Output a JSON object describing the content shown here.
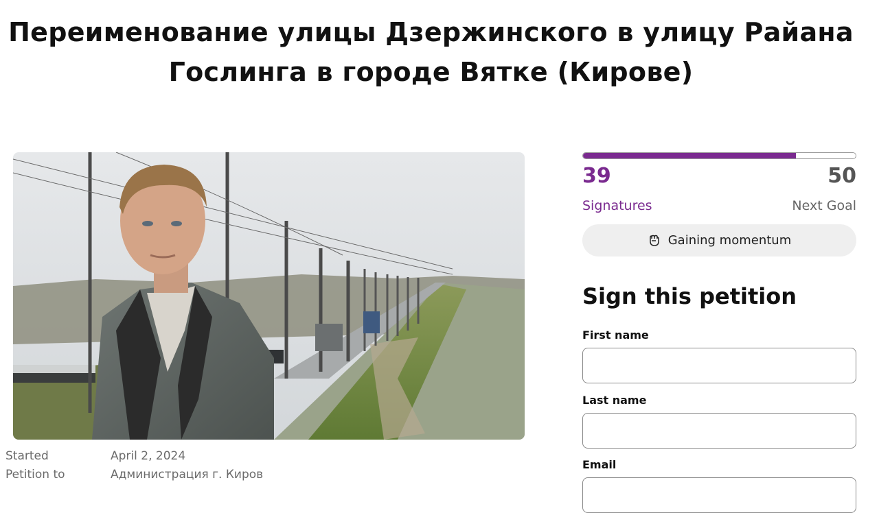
{
  "petition": {
    "title": "Переименование улицы Дзержинского в улицу Райана Гослинга в городе Вятке (Кирове)"
  },
  "meta": {
    "started_label": "Started",
    "started_value": "April 2, 2024",
    "petition_to_label": "Petition to",
    "petition_to_value": "Администрация г. Киров"
  },
  "signatures": {
    "count": "39",
    "count_label": "Signatures",
    "goal": "50",
    "goal_label": "Next Goal",
    "progress_fraction": 0.78
  },
  "momentum": {
    "label": "Gaining momentum",
    "icon": "fist-icon"
  },
  "form": {
    "heading": "Sign this petition",
    "first_name_label": "First name",
    "first_name_value": "",
    "last_name_label": "Last name",
    "last_name_value": "",
    "email_label": "Email",
    "email_value": ""
  },
  "colors": {
    "accent": "#7a2a8f",
    "muted": "#6b6b6b"
  }
}
